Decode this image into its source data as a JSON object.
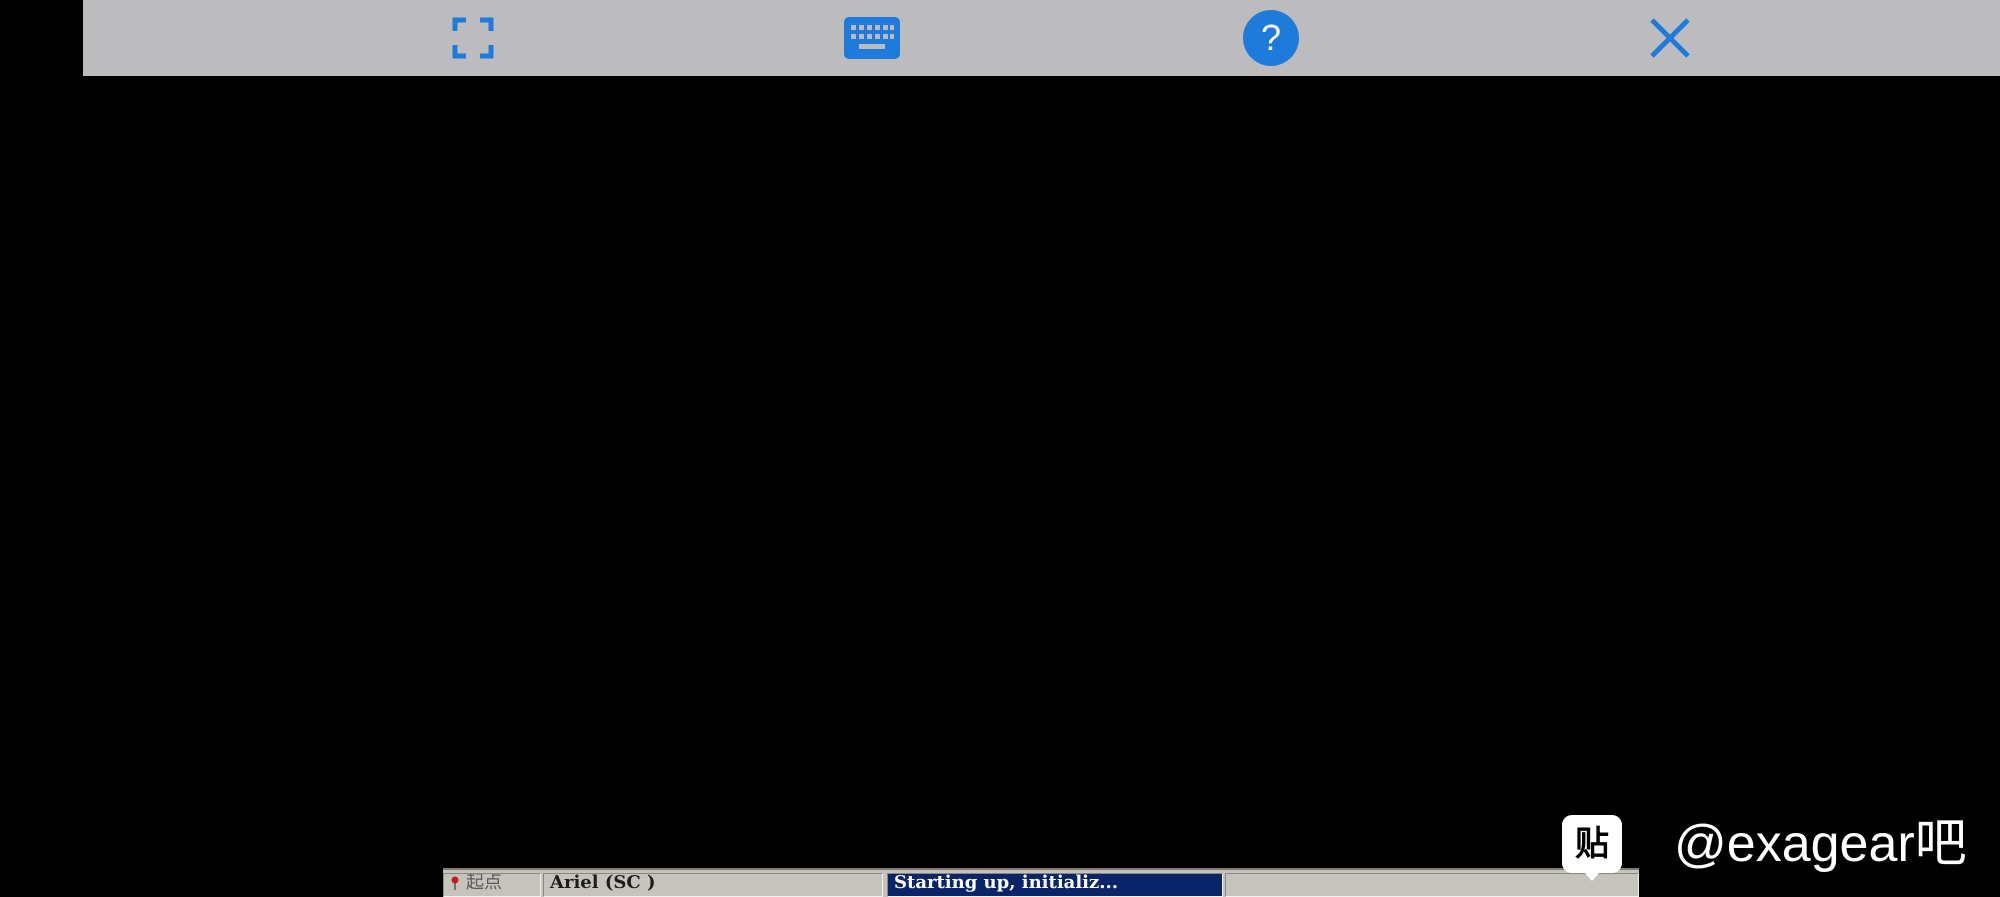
{
  "toolbar": {
    "buttons": [
      {
        "id": "fullscreen",
        "icon": "fullscreen-icon"
      },
      {
        "id": "keyboard",
        "icon": "keyboard-icon"
      },
      {
        "id": "help",
        "icon": "help-icon",
        "glyph": "?"
      },
      {
        "id": "close",
        "icon": "close-icon"
      }
    ],
    "background_color": "#bcbcbe",
    "icon_color": "#1e7bdc"
  },
  "statusbar": {
    "start_label": "起点",
    "font_label": "Ariel (SC )",
    "message": "Starting up, initializ..."
  },
  "watermark": {
    "logo_glyph": "贴",
    "text": "@exagear吧"
  }
}
